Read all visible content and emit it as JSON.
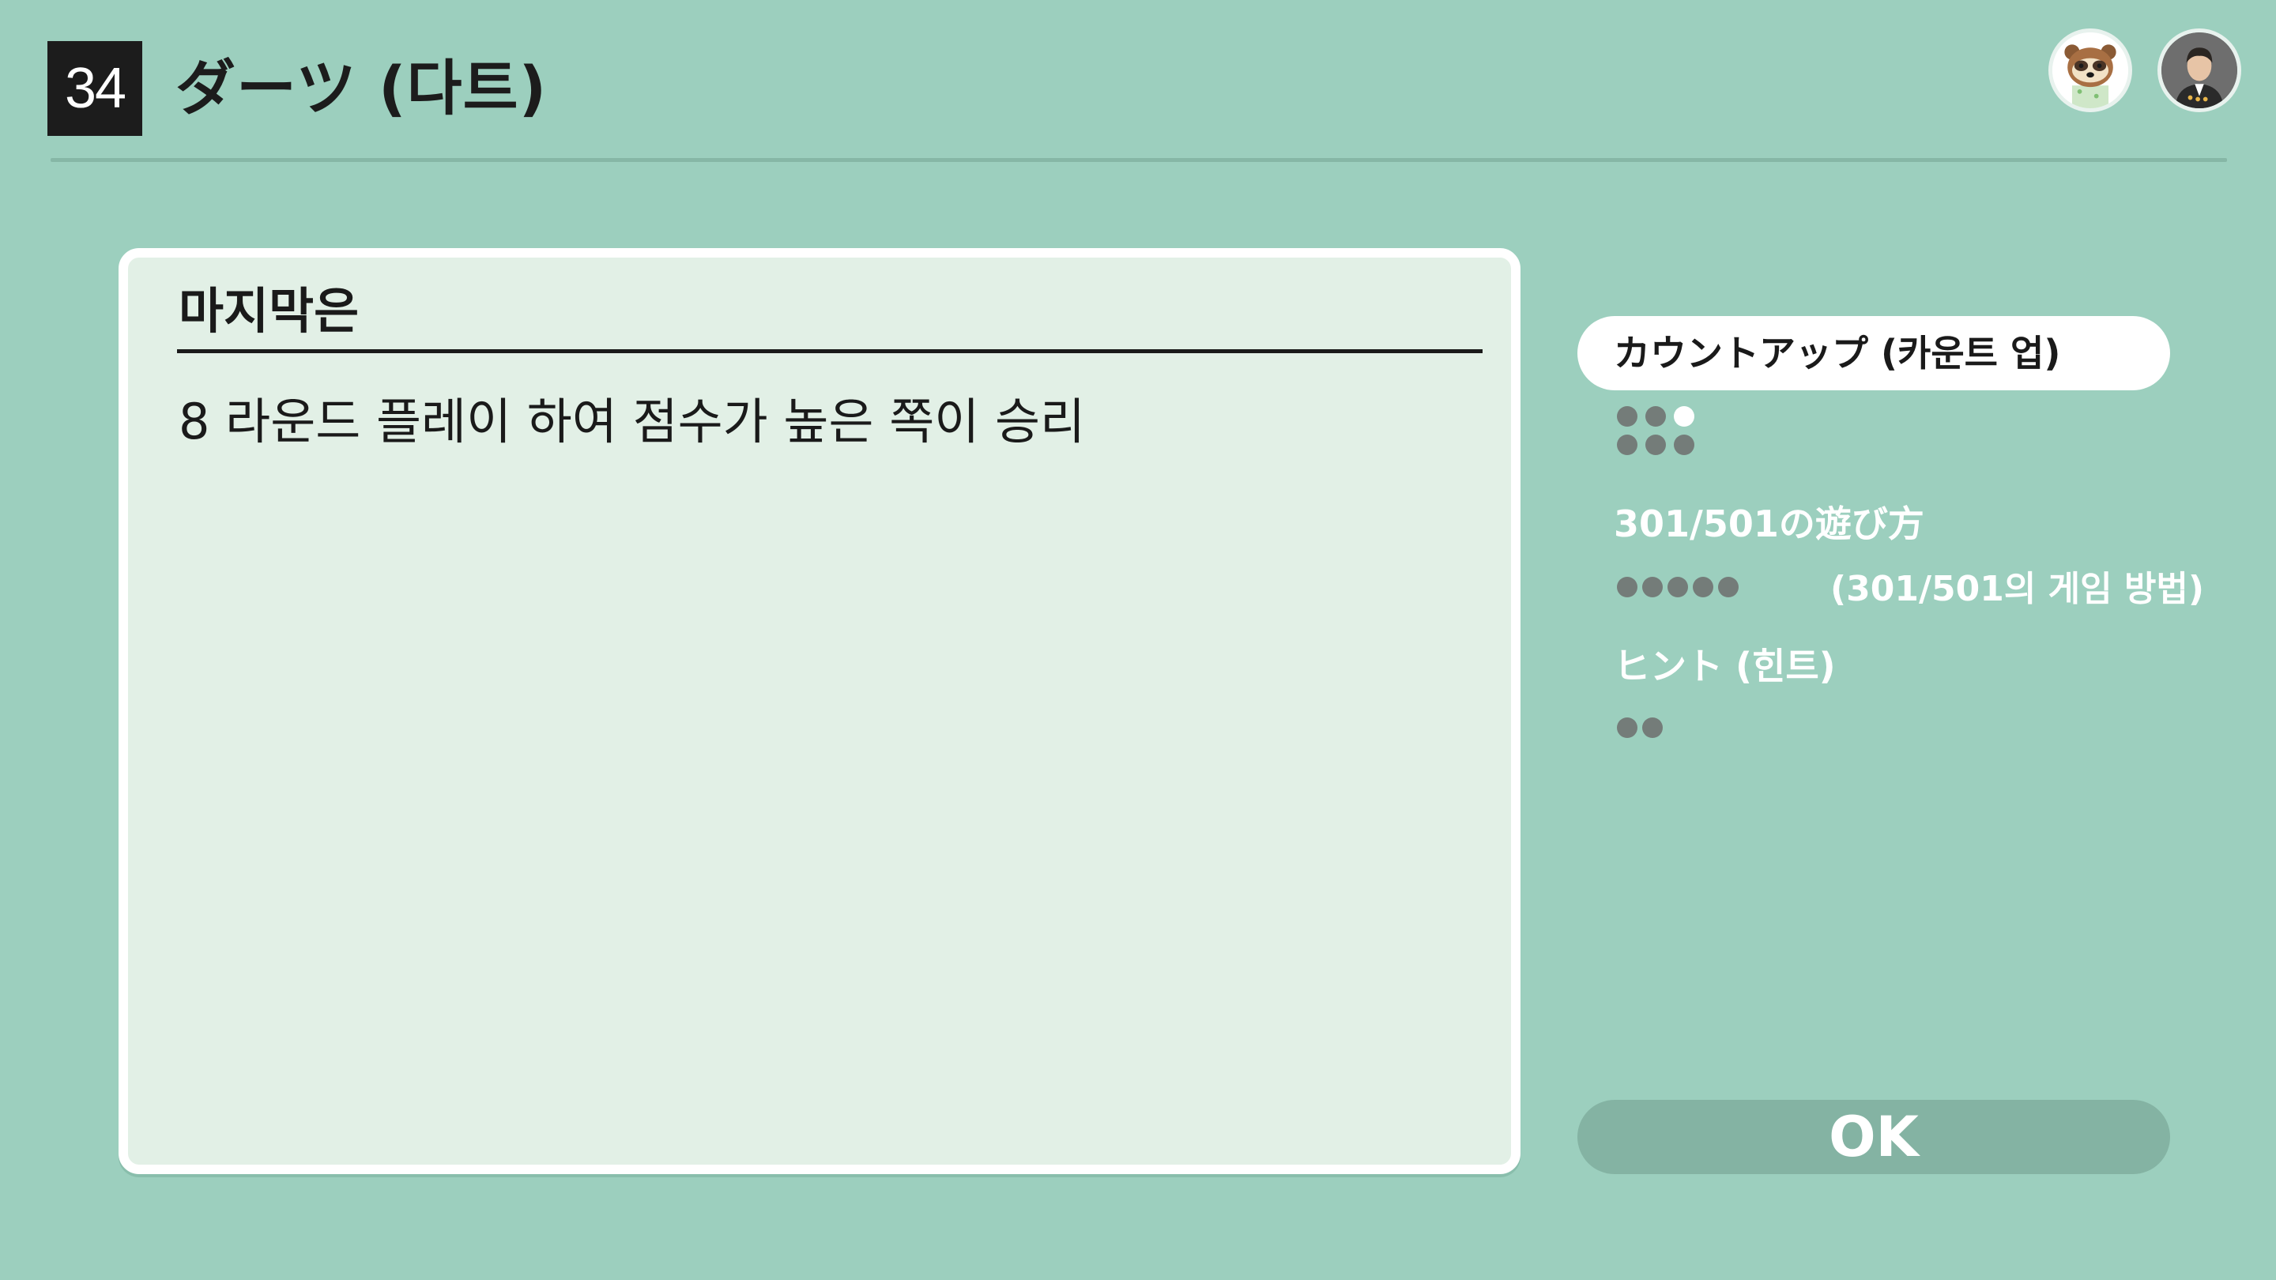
{
  "header": {
    "number": "34",
    "title": "ダーツ (다트)"
  },
  "panel": {
    "heading": "마지막은",
    "body": "8 라운드 플레이 하여 점수가 높은 쪽이 승리"
  },
  "menu": {
    "items": [
      {
        "label": "カウントアップ (카운트 업)",
        "selected": true,
        "dots": [
          false,
          false,
          true,
          false,
          false,
          false
        ]
      },
      {
        "label": "301/501の遊び方",
        "sublabel": "(301/501의 게임 방법)",
        "selected": false,
        "dots": [
          false,
          false,
          false,
          false,
          false
        ]
      },
      {
        "label": "ヒント (힌트)",
        "selected": false,
        "dots": [
          false,
          false
        ]
      }
    ]
  },
  "ok_button": {
    "label": "OK"
  },
  "avatars": [
    {
      "icon": "raccoon-shopkeeper-avatar-icon"
    },
    {
      "icon": "user-avatar-icon"
    }
  ],
  "colors": {
    "background": "#9ccfbe",
    "panel": "#e2f0e6",
    "dot_inactive": "#747c79",
    "dot_active": "#ffffff",
    "ok_button": "#84b3a3"
  }
}
